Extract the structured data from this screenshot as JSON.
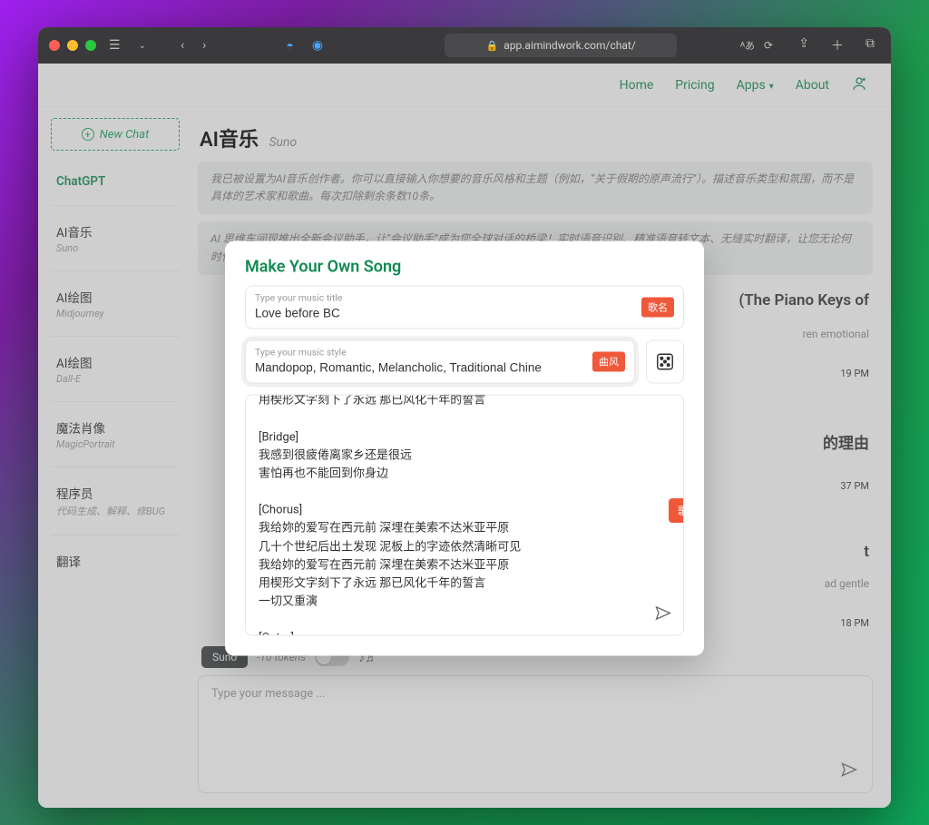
{
  "browser": {
    "url": "app.aimindwork.com/chat/"
  },
  "topnav": {
    "home": "Home",
    "pricing": "Pricing",
    "apps": "Apps",
    "about": "About"
  },
  "sidebar": {
    "new_chat": "New Chat",
    "items": [
      {
        "title": "ChatGPT",
        "sub": "",
        "active": true
      },
      {
        "title": "AI音乐",
        "sub": "Suno"
      },
      {
        "title": "AI绘图",
        "sub": "Midjourney"
      },
      {
        "title": "AI绘图",
        "sub": "Dall-E"
      },
      {
        "title": "魔法肖像",
        "sub": "MagicPortrait"
      },
      {
        "title": "程序员",
        "sub": "代码生成、解释、修BUG"
      },
      {
        "title": "翻译",
        "sub": ""
      }
    ]
  },
  "page": {
    "title": "AI音乐",
    "subtitle": "Suno",
    "notice1": "我已被设置为AI音乐创作者。你可以直接输入你想要的音乐风格和主题（例如，“关于假期的原声流行”）。描述音乐类型和氛围，而不是具体的艺术家和歌曲。每次扣除剩余条数10条。",
    "notice2": "AI 思维车间现推出全新会议助手，让“会议助手”成为您全球对话的桥梁！实时语音识别、精准语音转文本、无缝实时翻译，让您无论何时何地都能畅通无阻。更"
  },
  "conversation": {
    "peek_title1": "(The Piano Keys of",
    "peek_sub1": "ren emotional",
    "peek_ts1": "19 PM",
    "peek_title2": "的理由",
    "peek_ts2": "37 PM",
    "peek_title3": "t",
    "peek_sub3": "ad gentle",
    "peek_ts3": "18 PM"
  },
  "composer": {
    "pill": "Suno",
    "tokens": "-10 tokens",
    "placeholder": "Type your message ..."
  },
  "modal": {
    "title": "Make Your Own Song",
    "title_field": {
      "label": "Type your music title",
      "value": "Love before BC",
      "badge": "歌名"
    },
    "style_field": {
      "label": "Type your music style",
      "value": "Mandopop, Romantic, Melancholic, Traditional Chine",
      "badge": "曲风"
    },
    "lyrics_badge": "歌词",
    "lyrics": "用楔形文字刻下了永远 那已风化千年的誓言\n\n[Bridge]\n我感到很疲倦离家乡还是很远\n害怕再也不能回到你身边\n\n[Chorus]\n我给妳的爱写在西元前 深埋在美索不达米亚平原\n几十个世纪后出土发现 泥板上的字迹依然清晰可见\n我给妳的爱写在西元前 深埋在美索不达米亚平原\n用楔形文字刻下了永远 那已风化千年的誓言\n一切又重演\n\n[Outro]\n爱在西元前\n\n[End]"
  }
}
